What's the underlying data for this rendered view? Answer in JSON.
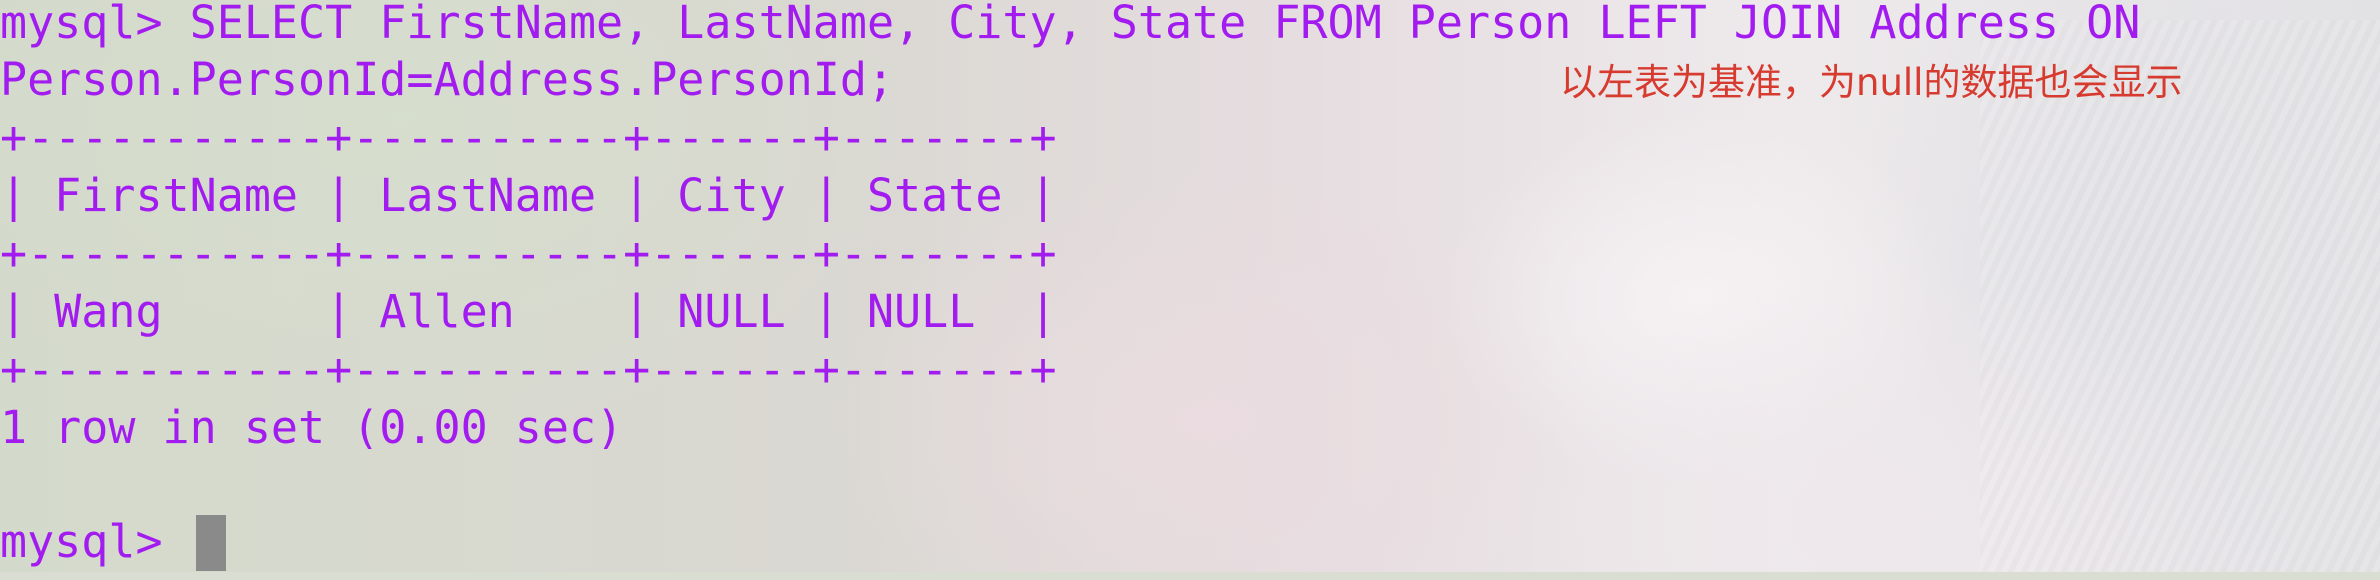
{
  "terminal": {
    "query_line_1": "mysql> SELECT FirstName, LastName, City, State FROM Person LEFT JOIN Address ON",
    "query_line_2": "Person.PersonId=Address.PersonId;",
    "table_border_top": "+-----------+----------+------+-------+",
    "table_header": "| FirstName | LastName | City | State |",
    "table_border_mid": "+-----------+----------+------+-------+",
    "table_row_1": "| Wang      | Allen    | NULL | NULL  |",
    "table_border_bottom": "+-----------+----------+------+-------+",
    "result_summary": "1 row in set (0.00 sec)",
    "prompt": "mysql> "
  },
  "annotation": {
    "text": "以左表为基准，为null的数据也会显示"
  },
  "colors": {
    "terminal_text": "#a21cf0",
    "annotation_text": "#d73a2e",
    "cursor": "#8a8a8a"
  }
}
